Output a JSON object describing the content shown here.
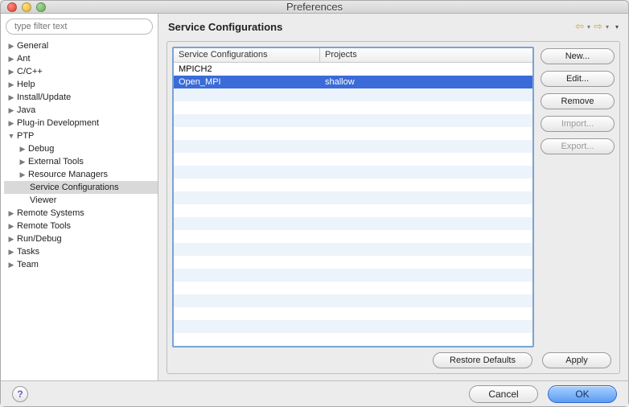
{
  "window": {
    "title": "Preferences"
  },
  "filter": {
    "placeholder": "type filter text"
  },
  "tree": {
    "general": "General",
    "ant": "Ant",
    "cpp": "C/C++",
    "help": "Help",
    "install": "Install/Update",
    "java": "Java",
    "plugin": "Plug-in Development",
    "ptp": "PTP",
    "debug": "Debug",
    "external": "External Tools",
    "resourcemgr": "Resource Managers",
    "serviceconf": "Service Configurations",
    "viewer": "Viewer",
    "remotesys": "Remote Systems",
    "remotetools": "Remote Tools",
    "rundebug": "Run/Debug",
    "tasks": "Tasks",
    "team": "Team"
  },
  "header": {
    "title": "Service Configurations"
  },
  "table": {
    "columns": {
      "c1": "Service Configurations",
      "c2": "Projects"
    },
    "rows": [
      {
        "name": "MPICH2",
        "projects": "",
        "selected": false
      },
      {
        "name": "Open_MPI",
        "projects": "shallow",
        "selected": true
      }
    ]
  },
  "buttons": {
    "new": "New...",
    "edit": "Edit...",
    "remove": "Remove",
    "import": "Import...",
    "export": "Export...",
    "restore": "Restore Defaults",
    "apply": "Apply",
    "cancel": "Cancel",
    "ok": "OK"
  }
}
